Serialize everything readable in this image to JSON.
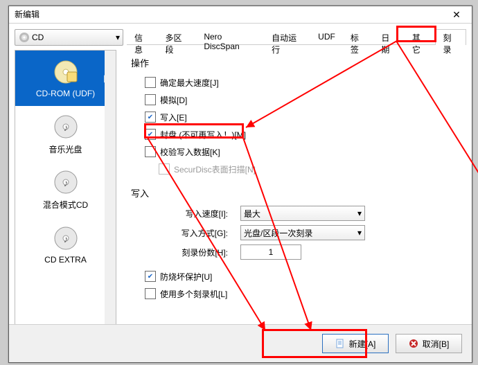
{
  "window": {
    "title": "新编辑",
    "close_glyph": "✕"
  },
  "disc_selector": {
    "label": "CD",
    "caret": "▾"
  },
  "sidebar": {
    "items": [
      {
        "label": "CD-ROM (UDF)"
      },
      {
        "label": "音乐光盘"
      },
      {
        "label": "混合模式CD"
      },
      {
        "label": "CD EXTRA"
      }
    ]
  },
  "tabs": [
    "信息",
    "多区段",
    "Nero DiscSpan",
    "自动运行",
    "UDF",
    "标签",
    "日期",
    "其它",
    "刻录"
  ],
  "page": {
    "section_action": "操作",
    "cb_max_speed": "确定最大速度[J]",
    "cb_simulate": "模拟[D]",
    "cb_write": "写入[E]",
    "cb_finalize": "封盘 (不可再写入！)[M]",
    "cb_verify": "校验写入数据[K]",
    "cb_securdisc": "SecurDisc表面扫描[N]",
    "section_write": "写入",
    "lbl_speed": "写入速度[I]:",
    "val_speed": "最大",
    "lbl_method": "写入方式[G]:",
    "val_method": "光盘/区段一次刻录",
    "lbl_copies": "刻录份数[H]:",
    "val_copies": "1",
    "cb_burnproof": "防烧坏保护[U]",
    "cb_multi": "使用多个刻录机[L]",
    "caret": "▾"
  },
  "buttons": {
    "new": "新建[A]",
    "cancel": "取消[B]"
  }
}
